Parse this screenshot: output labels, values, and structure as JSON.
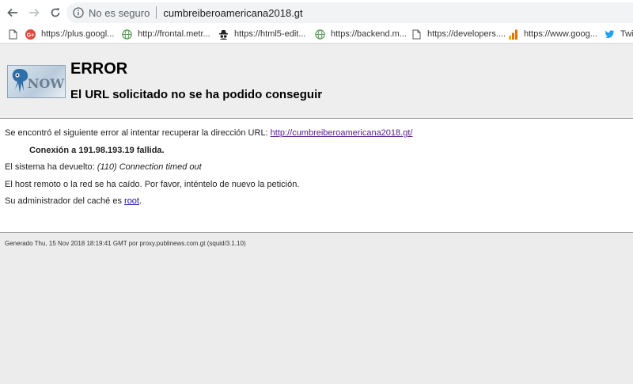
{
  "browser": {
    "security_label": "No es seguro",
    "url": "cumbreiberoamericana2018.gt"
  },
  "bookmarks": [
    {
      "label": "https://plus.googl...",
      "icon": "google-plus-icon"
    },
    {
      "label": "http://frontal.metr...",
      "icon": "globe-icon"
    },
    {
      "label": "https://html5-edit...",
      "icon": "spy-icon"
    },
    {
      "label": "https://backend.m...",
      "icon": "globe-icon"
    },
    {
      "label": "https://developers....",
      "icon": "page-icon"
    },
    {
      "label": "https://www.goog...",
      "icon": "analytics-icon"
    },
    {
      "label": "Twi",
      "icon": "twitter-icon"
    }
  ],
  "error_page": {
    "title": "ERROR",
    "subtitle": "El URL solicitado no se ha podido conseguir",
    "line1_text": "Se encontró el siguiente error al intentar recuperar la dirección URL: ",
    "line1_link": "http://cumbreiberoamericana2018.gt/",
    "line2": "Conexión a 191.98.193.19 fallida.",
    "line3_text": "El sistema ha devuelto: ",
    "line3_italic": "(110) Connection timed out",
    "line4": "El host remoto o la red se ha caído. Por favor, inténtelo de nuevo la petición.",
    "line5_text": "Su administrador del caché es ",
    "line5_link": "root",
    "line5_end": ".",
    "footer": "Generado Thu, 15 Nov 2018 18:19:41 GMT por proxy.publinews.com.gt (squid/3.1.10)",
    "logo_text": "NOW"
  },
  "colors": {
    "link": "#1a0dab",
    "visited_link": "#551a8b",
    "page_bg": "#ececec"
  }
}
